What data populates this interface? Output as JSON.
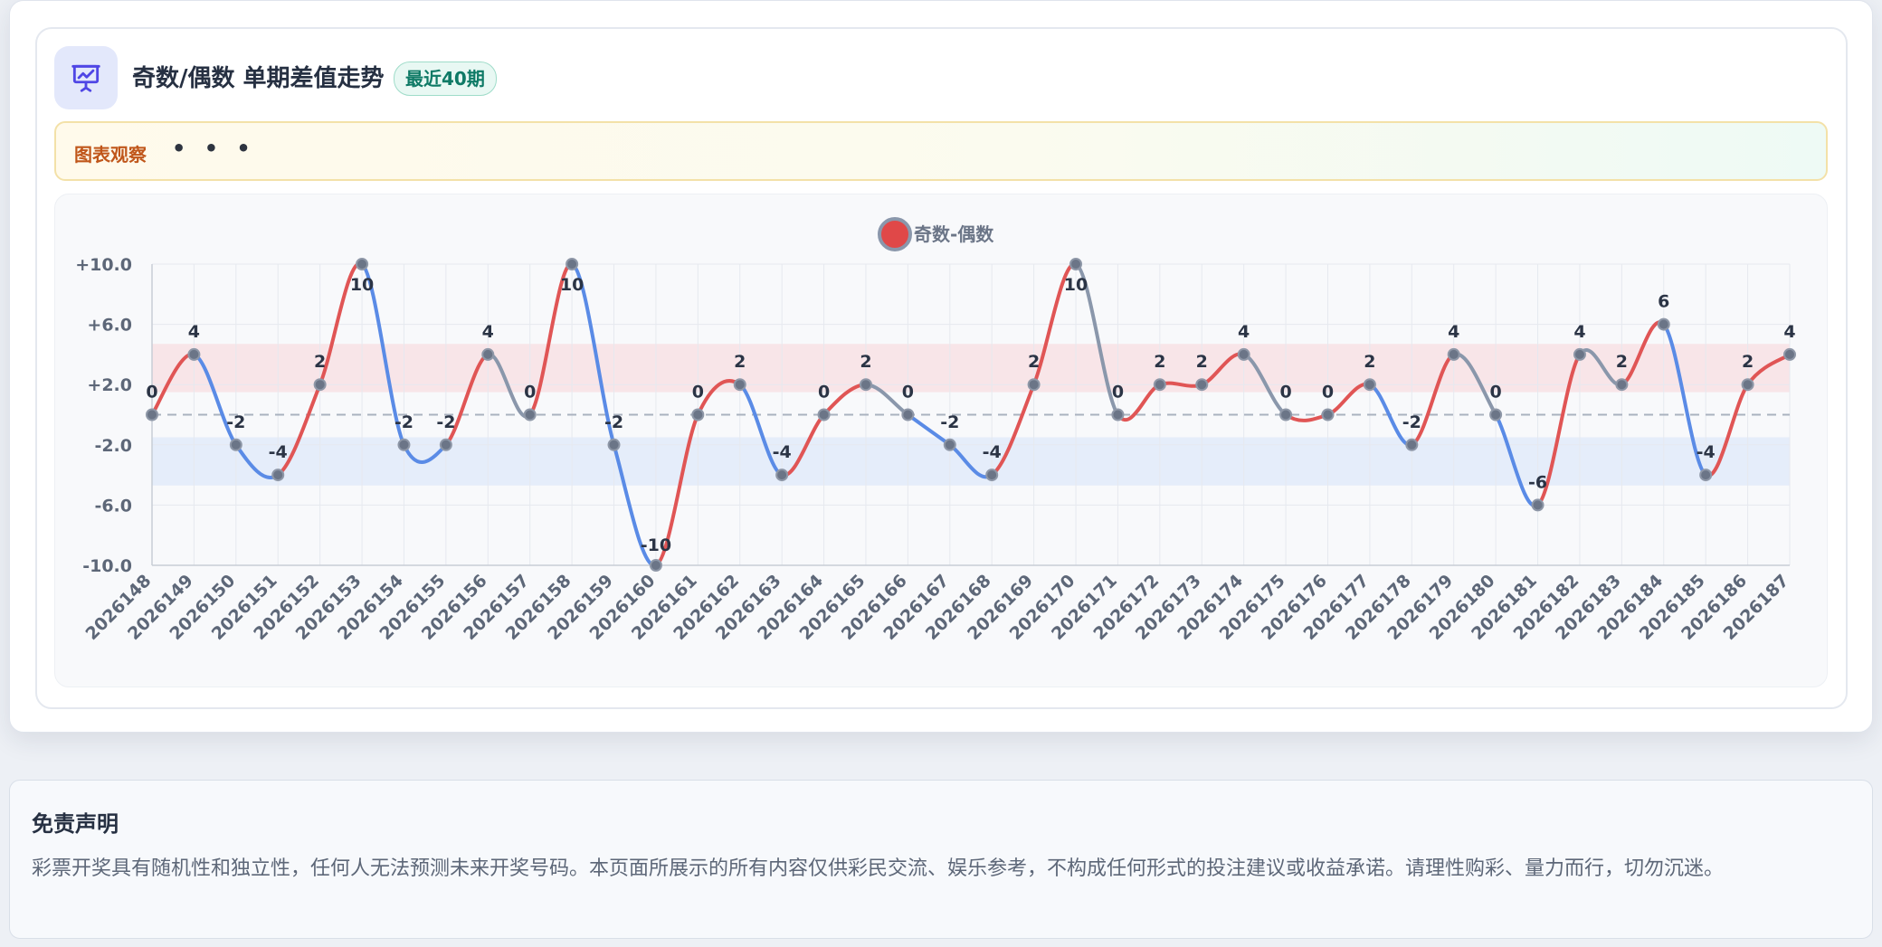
{
  "header": {
    "title": "奇数/偶数 单期差值走势",
    "badge": "最近40期",
    "icon": "presentation-chart-icon"
  },
  "insight": {
    "label": "图表观察",
    "dots": "• • •"
  },
  "chart_data": {
    "type": "line",
    "smooth": true,
    "legend": {
      "label": "奇数-偶数",
      "position": "top-center",
      "marker_color": "#e04848"
    },
    "colors": {
      "positive": "#e05555",
      "negative": "#5a8be6",
      "neutral": "#8a97ab",
      "point": "#6b7587"
    },
    "x": [
      "2026148",
      "2026149",
      "2026150",
      "2026151",
      "2026152",
      "2026153",
      "2026154",
      "2026155",
      "2026156",
      "2026157",
      "2026158",
      "2026159",
      "2026160",
      "2026161",
      "2026162",
      "2026163",
      "2026164",
      "2026165",
      "2026166",
      "2026167",
      "2026168",
      "2026169",
      "2026170",
      "2026171",
      "2026172",
      "2026173",
      "2026174",
      "2026175",
      "2026176",
      "2026177",
      "2026178",
      "2026179",
      "2026180",
      "2026181",
      "2026182",
      "2026183",
      "2026184",
      "2026185",
      "2026186",
      "2026187"
    ],
    "series": [
      {
        "values": [
          0,
          4,
          -2,
          -4,
          2,
          10,
          -2,
          -2,
          4,
          0,
          10,
          -2,
          -10,
          0,
          2,
          -4,
          0,
          2,
          0,
          -2,
          -4,
          2,
          10,
          0,
          2,
          2,
          4,
          0,
          0,
          2,
          -2,
          4,
          0,
          -6,
          4,
          2,
          6,
          -4,
          2,
          4
        ]
      }
    ],
    "ylim": [
      -10,
      10
    ],
    "yticks": [
      "+10.0",
      "+6.0",
      "+2.0",
      "-2.0",
      "-6.0",
      "-10.0"
    ],
    "ytick_values": [
      10,
      6,
      2,
      -2,
      -6,
      -10
    ],
    "bands": [
      {
        "from": 1.5,
        "to": 4.7,
        "color": "#f8dde2"
      },
      {
        "from": -4.7,
        "to": -1.5,
        "color": "#dfe8fa"
      }
    ],
    "zero_line": true,
    "grid": true
  },
  "disclaimer": {
    "title": "免责声明",
    "text": "彩票开奖具有随机性和独立性，任何人无法预测未来开奖号码。本页面所展示的所有内容仅供彩民交流、娱乐参考，不构成任何形式的投注建议或收益承诺。请理性购彩、量力而行，切勿沉迷。"
  }
}
